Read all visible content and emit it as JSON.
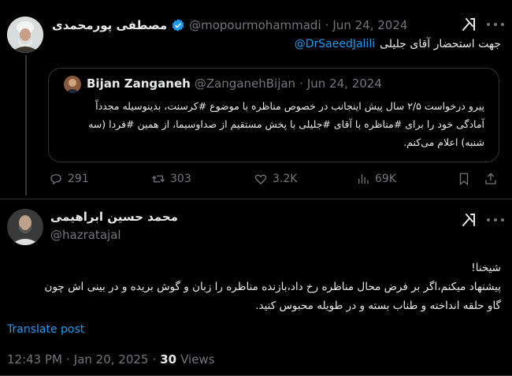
{
  "tweet1": {
    "author_name": "مصطفی پورمحمدی",
    "handle": "@mopourmohammadi",
    "sep": "·",
    "date": "Jun 24, 2024",
    "text": "جهت استحضار آقای جلیلی",
    "mention": "@DrSaeedJalili",
    "quote": {
      "author_name": "Bijan Zanganeh",
      "handle": "@ZanganehBijan",
      "sep": "·",
      "date": "Jun 24, 2024",
      "line1": "پیرو درخواست ۲/۵ سال پیش اینجانب در خصوص مناظره با موضوع #کرسنت، بدینوسیله مجدداً",
      "line2": "آمادگی خود را برای #مناظره با آقای #جلیلی با پخش مستقیم از صداوسیما، از همین #فردا (سه",
      "line3": "شنبه) اعلام می‌کنم."
    },
    "actions": {
      "replies": "291",
      "reposts": "303",
      "likes": "3.2K",
      "views": "69K"
    }
  },
  "tweet2": {
    "author_name": "محمد حسین ابراهیمی",
    "handle": "@hazratajal",
    "line1": "شیخنا!",
    "line2": "پیشنهاد میکنم،اگر بر فرض محال مناظره رخ داد،بازنده مناظره را زبان و گوش بریده و در بینی اش چون",
    "line3": "گاو حلقه انداخته و طناب بسته و در طویله محبوس کنید.",
    "translate_label": "Translate post",
    "time": "12:43 PM",
    "sep": "·",
    "date": "Jan 20, 2025",
    "views_count": "30",
    "views_label": "Views"
  },
  "icons": {
    "verified": "verified-badge-icon",
    "grok": "grok-icon",
    "more": "more-icon",
    "reply": "reply-icon",
    "repost": "repost-icon",
    "like": "like-icon",
    "views": "views-icon",
    "bookmark": "bookmark-icon",
    "share": "share-icon"
  },
  "colors": {
    "background": "#000000",
    "text": "#e7e9ea",
    "muted": "#71767b",
    "link": "#1d9bf0",
    "verified": "#1d9bf0",
    "border": "#2f3336"
  }
}
